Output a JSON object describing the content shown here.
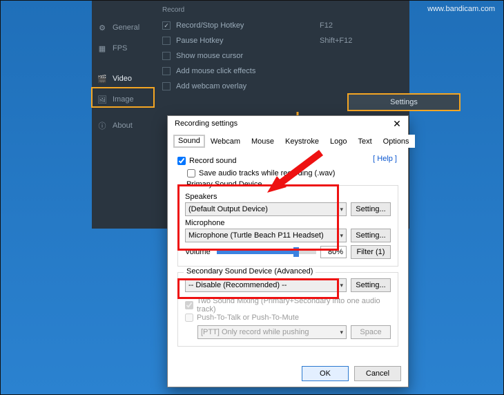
{
  "watermark": "www.bandicam.com",
  "sidebar": {
    "items": [
      {
        "label": "General"
      },
      {
        "label": "FPS"
      },
      {
        "label": "Video"
      },
      {
        "label": "Image"
      },
      {
        "label": "About"
      }
    ]
  },
  "record": {
    "title": "Record",
    "record_stop": {
      "label": "Record/Stop Hotkey",
      "value": "F12",
      "checked": true
    },
    "pause": {
      "label": "Pause Hotkey",
      "value": "Shift+F12",
      "checked": false
    },
    "mouse_cursor": {
      "label": "Show mouse cursor",
      "checked": false
    },
    "click_fx": {
      "label": "Add mouse click effects",
      "checked": false
    },
    "webcam": {
      "label": "Add webcam overlay",
      "checked": false
    },
    "settings_btn": "Settings"
  },
  "dialog": {
    "title": "Recording settings",
    "tabs": [
      "Sound",
      "Webcam",
      "Mouse",
      "Keystroke",
      "Logo",
      "Text",
      "Options"
    ],
    "record_sound": "Record sound",
    "save_wav": "Save audio tracks while recording (.wav)",
    "help": "[ Help ]",
    "primary": {
      "title": "Primary Sound Device",
      "speakers_label": "Speakers",
      "speakers_value": "(Default Output Device)",
      "mic_label": "Microphone",
      "mic_value": "Microphone (Turtle Beach P11 Headset)",
      "volume_label": "Volume",
      "volume_value": "80%",
      "setting_btn": "Setting...",
      "filter_btn": "Filter (1)"
    },
    "secondary": {
      "title": "Secondary Sound Device (Advanced)",
      "value": "-- Disable (Recommended) --",
      "setting_btn": "Setting..."
    },
    "mixing": "Two Sound Mixing (Primary+Secondary into one audio track)",
    "ptt": "Push-To-Talk or Push-To-Mute",
    "ptt_mode": "[PTT] Only record while pushing",
    "ptt_key": "Space",
    "ok": "OK",
    "cancel": "Cancel"
  }
}
